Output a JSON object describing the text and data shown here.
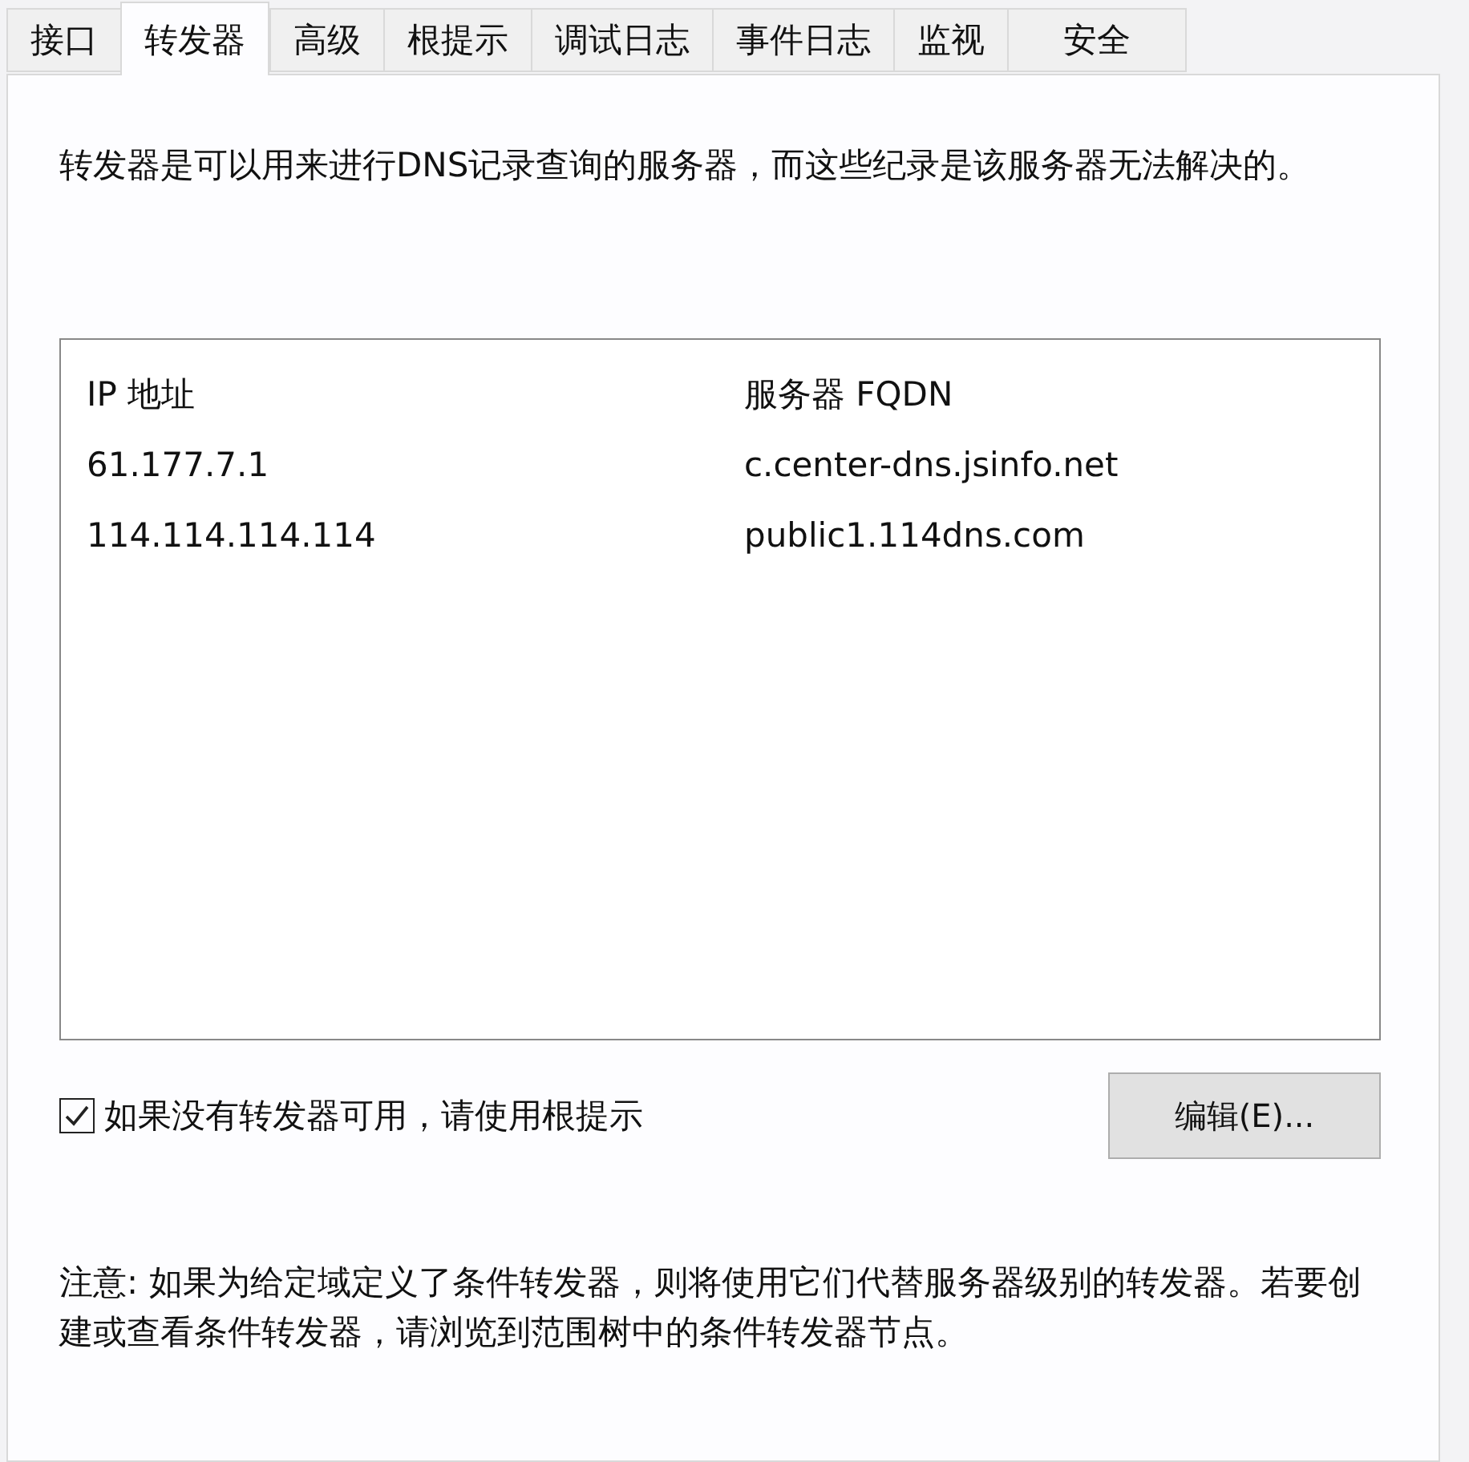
{
  "tabs": [
    {
      "label": "接口",
      "selected": false
    },
    {
      "label": "转发器",
      "selected": true
    },
    {
      "label": "高级",
      "selected": false
    },
    {
      "label": "根提示",
      "selected": false
    },
    {
      "label": "调试日志",
      "selected": false
    },
    {
      "label": "事件日志",
      "selected": false
    },
    {
      "label": "监视",
      "selected": false
    },
    {
      "label": "安全",
      "selected": false
    }
  ],
  "description": "转发器是可以用来进行DNS记录查询的服务器，而这些纪录是该服务器无法解决的。",
  "forwarders_table": {
    "columns": [
      "IP 地址",
      "服务器 FQDN"
    ],
    "rows": [
      [
        "61.177.7.1",
        "c.center-dns.jsinfo.net"
      ],
      [
        "114.114.114.114",
        "public1.114dns.com"
      ]
    ]
  },
  "use_root_hints": {
    "label": "如果没有转发器可用，请使用根提示",
    "checked": true
  },
  "edit_button": "编辑(E)...",
  "note": "注意: 如果为给定域定义了条件转发器，则将使用它们代替服务器级别的转发器。若要创建或查看条件转发器，请浏览到范围树中的条件转发器节点。"
}
